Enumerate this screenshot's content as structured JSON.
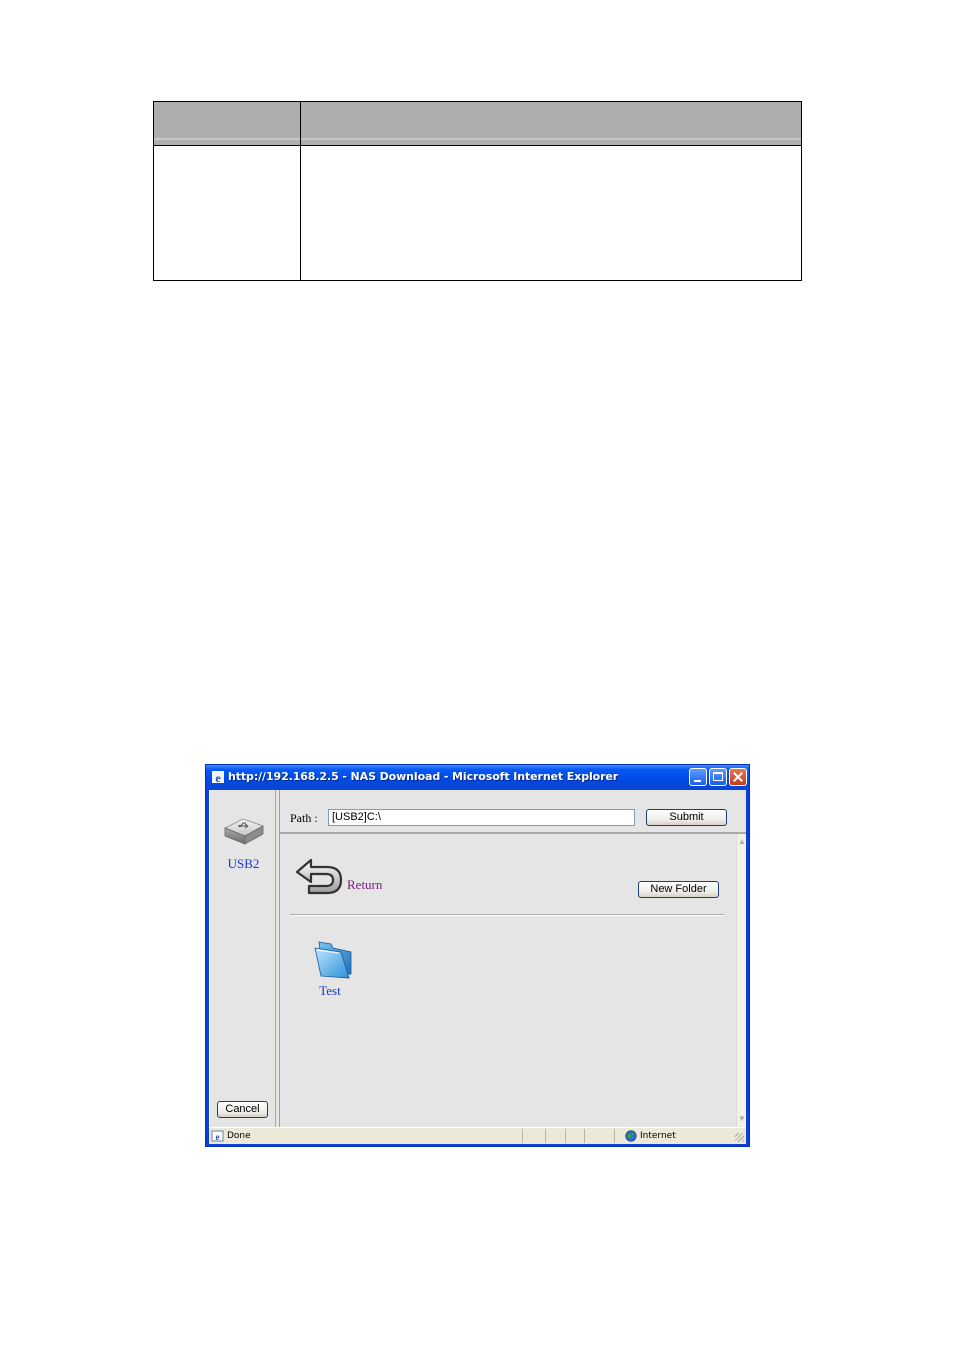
{
  "window": {
    "title": "http://192.168.2.5 - NAS Download - Microsoft Internet Explorer"
  },
  "sidebar": {
    "drive_label": "USB2",
    "cancel_label": "Cancel"
  },
  "path_bar": {
    "label": "Path :",
    "value": "[USB2]C:\\",
    "submit_label": "Submit"
  },
  "content": {
    "return_label": "Return",
    "new_folder_label": "New Folder",
    "folders": [
      {
        "name": "Test"
      }
    ]
  },
  "statusbar": {
    "status": "Done",
    "zone": "Internet"
  },
  "colors": {
    "titlebar": "#0049e3",
    "link": "#1c35c8",
    "return_link": "#7b1a7b",
    "table_header": "#aeaeae"
  }
}
